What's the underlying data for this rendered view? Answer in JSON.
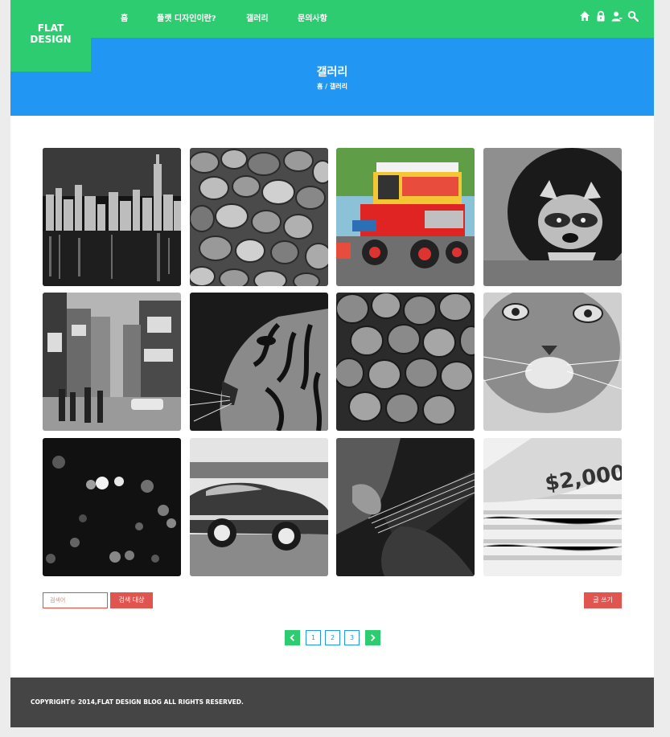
{
  "logo": {
    "line1": "FLAT",
    "line2": "DESIGN"
  },
  "nav": {
    "items": [
      {
        "label": "홈"
      },
      {
        "label": "플랫 디자인이란?"
      },
      {
        "label": "갤러리"
      },
      {
        "label": "문의사항"
      }
    ]
  },
  "header_icons": [
    "home-icon",
    "lock-icon",
    "user-icon",
    "search-icon"
  ],
  "banner": {
    "title": "갤러리",
    "breadcrumb": "홈 / 갤러리"
  },
  "gallery": {
    "items": [
      {
        "subject": "city-skyline-night"
      },
      {
        "subject": "pebbles"
      },
      {
        "subject": "colorful-jeep"
      },
      {
        "subject": "raccoon"
      },
      {
        "subject": "city-street"
      },
      {
        "subject": "tiger"
      },
      {
        "subject": "strawberries"
      },
      {
        "subject": "cat"
      },
      {
        "subject": "bokeh-lights"
      },
      {
        "subject": "vintage-car"
      },
      {
        "subject": "guitar"
      },
      {
        "subject": "money"
      }
    ]
  },
  "search": {
    "placeholder": "검색어",
    "button": "검색 대상"
  },
  "write_button": "글 쓰기",
  "pagination": {
    "pages": [
      "1",
      "2",
      "3"
    ]
  },
  "footer": {
    "copyright": "COPYRIGHT© 2014,FLAT DESIGN BLOG ALL RIGHTS RESERVED."
  },
  "colors": {
    "green": "#2ecc71",
    "blue": "#2196f3",
    "red": "#e0554f",
    "footer": "#454545"
  }
}
